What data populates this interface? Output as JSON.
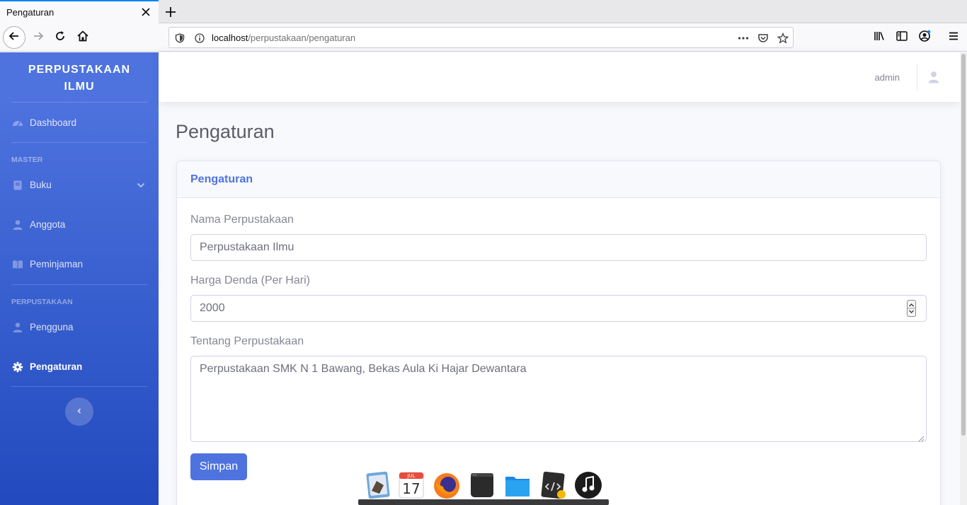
{
  "browser": {
    "tab_title": "Pengaturan",
    "url_host": "localhost",
    "url_path": "/perpustakaan/pengaturan"
  },
  "sidebar": {
    "brand_line1": "PERPUSTAKAAN",
    "brand_line2": "ILMU",
    "headings": [
      "MASTER",
      "PERPUSTAKAAN"
    ],
    "items": [
      {
        "label": "Dashboard",
        "icon": "tachometer-icon"
      },
      {
        "label": "Buku",
        "icon": "book-icon"
      },
      {
        "label": "Anggota",
        "icon": "user-icon"
      },
      {
        "label": "Peminjaman",
        "icon": "book-open-icon"
      },
      {
        "label": "Pengguna",
        "icon": "user-icon"
      },
      {
        "label": "Pengaturan",
        "icon": "gear-icon",
        "active": true
      }
    ]
  },
  "topbar": {
    "user_name": "admin"
  },
  "main": {
    "page_title": "Pengaturan",
    "card_title": "Pengaturan",
    "fields": {
      "nama_label": "Nama Perpustakaan",
      "nama_value": "Perpustakaan Ilmu",
      "denda_label": "Harga Denda (Per Hari)",
      "denda_value": "2000",
      "tentang_label": "Tentang Perpustakaan",
      "tentang_value": "Perpustakaan SMK N 1 Bawang, Bekas Aula Ki Hajar Dewantara"
    },
    "save_label": "Simpan"
  },
  "dock": {
    "items": [
      "finder-icon",
      "calendar-icon",
      "firefox-icon",
      "terminal-icon",
      "folder-icon",
      "code-editor-icon",
      "music-icon"
    ],
    "calendar_month": "JUL",
    "calendar_day": "17"
  },
  "colors": {
    "primary": "#4e73df",
    "sidebar_gradient_end": "#224abe"
  }
}
